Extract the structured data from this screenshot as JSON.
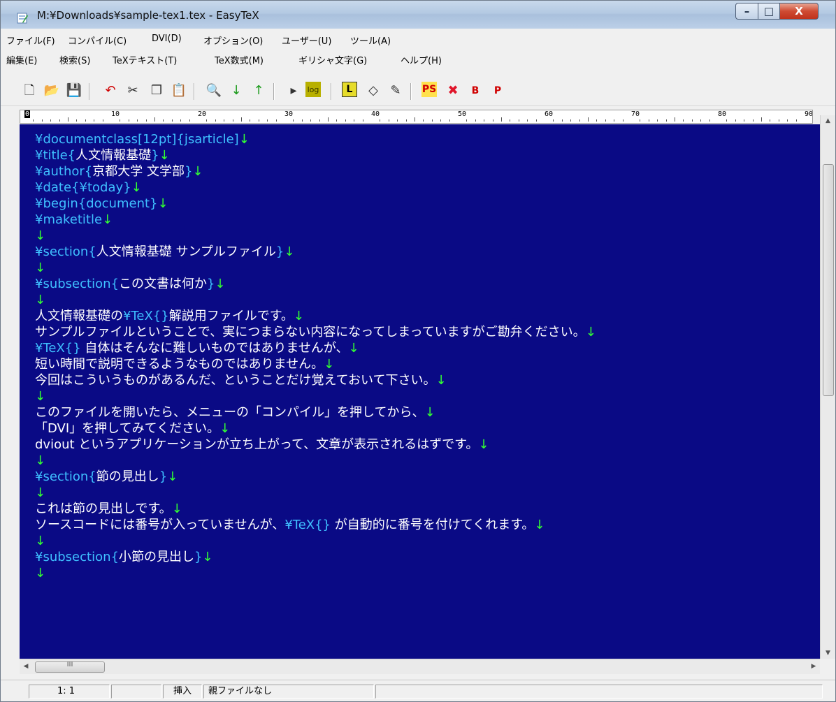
{
  "window": {
    "title": "M:¥Downloads¥sample-tex1.tex - EasyTeX",
    "minimize_glyph": "–",
    "maximize_glyph": "□",
    "close_glyph": "X"
  },
  "menus": {
    "row1": [
      "ファイル(F)",
      "コンパイル(C)",
      "DVI(D)",
      "オプション(O)",
      "ユーザー(U)",
      "ツール(A)"
    ],
    "row2": [
      "編集(E)",
      "検索(S)",
      "TeXテキスト(T)",
      "TeX数式(M)",
      "ギリシャ文字(G)",
      "ヘルプ(H)"
    ]
  },
  "toolbar": [
    {
      "name": "new-file-icon",
      "glyph": "🗋",
      "color": "#333333"
    },
    {
      "name": "open-folder-icon",
      "glyph": "📂",
      "color": "#c89b2a"
    },
    {
      "name": "save-icon",
      "glyph": "💾",
      "color": "#1b2b6b"
    },
    {
      "name": "undo-icon",
      "glyph": "↶",
      "color": "#d00000"
    },
    {
      "name": "cut-icon",
      "glyph": "✂",
      "color": "#333333"
    },
    {
      "name": "copy-icon",
      "glyph": "❐",
      "color": "#333333"
    },
    {
      "name": "paste-icon",
      "glyph": "📋",
      "color": "#444444"
    },
    {
      "name": "find-icon",
      "glyph": "🔍",
      "color": "#333333"
    },
    {
      "name": "down-arrow-icon",
      "glyph": "↓",
      "color": "#1a9a1a"
    },
    {
      "name": "up-arrow-icon",
      "glyph": "↑",
      "color": "#1a9a1a"
    },
    {
      "name": "dvi-icon",
      "glyph": "▸",
      "color": "#333333"
    },
    {
      "name": "log-icon",
      "glyph": "log",
      "color": "#333300"
    },
    {
      "name": "latex-icon",
      "glyph": "L",
      "color": "#000000"
    },
    {
      "name": "eraser-icon",
      "glyph": "◇",
      "color": "#333333"
    },
    {
      "name": "edit-icon",
      "glyph": "✎",
      "color": "#333333"
    },
    {
      "name": "ps-icon",
      "glyph": "PS",
      "color": "#d00000"
    },
    {
      "name": "pdf-icon",
      "glyph": "✖",
      "color": "#e0162b"
    },
    {
      "name": "bibtex-icon",
      "glyph": "B",
      "color": "#d00000"
    },
    {
      "name": "pbibtex-icon",
      "glyph": "P",
      "color": "#d00000"
    }
  ],
  "ruler": [
    "0",
    "10",
    "20",
    "30",
    "40",
    "50",
    "60",
    "70",
    "80",
    "90"
  ],
  "editor": {
    "lines": [
      [
        {
          "t": "¥documentclass[12pt]{jsarticle]",
          "c": "cmd"
        },
        {
          "t": "↓",
          "c": "arr"
        }
      ],
      [
        {
          "t": "¥title{",
          "c": "cmd"
        },
        {
          "t": "人文情報基礎",
          "c": "txt"
        },
        {
          "t": "}",
          "c": "cmd"
        },
        {
          "t": "↓",
          "c": "arr"
        }
      ],
      [
        {
          "t": "¥author{",
          "c": "cmd"
        },
        {
          "t": "京都大学 文学部",
          "c": "txt"
        },
        {
          "t": "}",
          "c": "cmd"
        },
        {
          "t": "↓",
          "c": "arr"
        }
      ],
      [
        {
          "t": "¥date{¥today}",
          "c": "cmd"
        },
        {
          "t": "↓",
          "c": "arr"
        }
      ],
      [
        {
          "t": "¥begin{document}",
          "c": "cmd"
        },
        {
          "t": "↓",
          "c": "arr"
        }
      ],
      [
        {
          "t": "¥maketitle",
          "c": "cmd"
        },
        {
          "t": "↓",
          "c": "arr"
        }
      ],
      [
        {
          "t": "↓",
          "c": "arr"
        }
      ],
      [
        {
          "t": "¥section{",
          "c": "cmd"
        },
        {
          "t": "人文情報基礎 サンプルファイル",
          "c": "txt"
        },
        {
          "t": "}",
          "c": "cmd"
        },
        {
          "t": "↓",
          "c": "arr"
        }
      ],
      [
        {
          "t": "↓",
          "c": "arr"
        }
      ],
      [
        {
          "t": "¥subsection{",
          "c": "cmd"
        },
        {
          "t": "この文書は何か",
          "c": "txt"
        },
        {
          "t": "}",
          "c": "cmd"
        },
        {
          "t": "↓",
          "c": "arr"
        }
      ],
      [
        {
          "t": "↓",
          "c": "arr"
        }
      ],
      [
        {
          "t": "人文情報基礎の",
          "c": "txt"
        },
        {
          "t": "¥TeX{}",
          "c": "cmd"
        },
        {
          "t": "解説用ファイルです。",
          "c": "txt"
        },
        {
          "t": "↓",
          "c": "arr"
        }
      ],
      [
        {
          "t": "サンプルファイルということで、実につまらない内容になってしまっていますがご勘弁ください。",
          "c": "txt"
        },
        {
          "t": "↓",
          "c": "arr"
        }
      ],
      [
        {
          "t": "¥TeX{}",
          "c": "cmd"
        },
        {
          "t": " 自体はそんなに難しいものではありませんが、",
          "c": "txt"
        },
        {
          "t": "↓",
          "c": "arr"
        }
      ],
      [
        {
          "t": "短い時間で説明できるようなものではありません。",
          "c": "txt"
        },
        {
          "t": "↓",
          "c": "arr"
        }
      ],
      [
        {
          "t": "今回はこういうものがあるんだ、ということだけ覚えておいて下さい。",
          "c": "txt"
        },
        {
          "t": "↓",
          "c": "arr"
        }
      ],
      [
        {
          "t": "↓",
          "c": "arr"
        }
      ],
      [
        {
          "t": "このファイルを開いたら、メニューの「コンパイル」を押してから、",
          "c": "txt"
        },
        {
          "t": "↓",
          "c": "arr"
        }
      ],
      [
        {
          "t": "「DVI」を押してみてください。",
          "c": "txt"
        },
        {
          "t": "↓",
          "c": "arr"
        }
      ],
      [
        {
          "t": "dviout というアプリケーションが立ち上がって、文章が表示されるはずです。",
          "c": "txt"
        },
        {
          "t": "↓",
          "c": "arr"
        }
      ],
      [
        {
          "t": "↓",
          "c": "arr"
        }
      ],
      [
        {
          "t": "¥section{",
          "c": "cmd"
        },
        {
          "t": "節の見出し",
          "c": "txt"
        },
        {
          "t": "}",
          "c": "cmd"
        },
        {
          "t": "↓",
          "c": "arr"
        }
      ],
      [
        {
          "t": "↓",
          "c": "arr"
        }
      ],
      [
        {
          "t": "これは節の見出しです。",
          "c": "txt"
        },
        {
          "t": "↓",
          "c": "arr"
        }
      ],
      [
        {
          "t": "ソースコードには番号が入っていませんが、",
          "c": "txt"
        },
        {
          "t": "¥TeX{}",
          "c": "cmd"
        },
        {
          "t": " が自動的に番号を付けてくれます。",
          "c": "txt"
        },
        {
          "t": "↓",
          "c": "arr"
        }
      ],
      [
        {
          "t": "↓",
          "c": "arr"
        }
      ],
      [
        {
          "t": "¥subsection{",
          "c": "cmd"
        },
        {
          "t": "小節の見出し",
          "c": "txt"
        },
        {
          "t": "}",
          "c": "cmd"
        },
        {
          "t": "↓",
          "c": "arr"
        }
      ],
      [
        {
          "t": "↓",
          "c": "arr"
        }
      ]
    ]
  },
  "scrollbar": {
    "up": "▲",
    "down": "▼",
    "left": "◀",
    "right": "▶",
    "grip": "III"
  },
  "statusbar": {
    "position": "1:  1",
    "mode": "挿入",
    "parent_file": "親ファイルなし"
  }
}
